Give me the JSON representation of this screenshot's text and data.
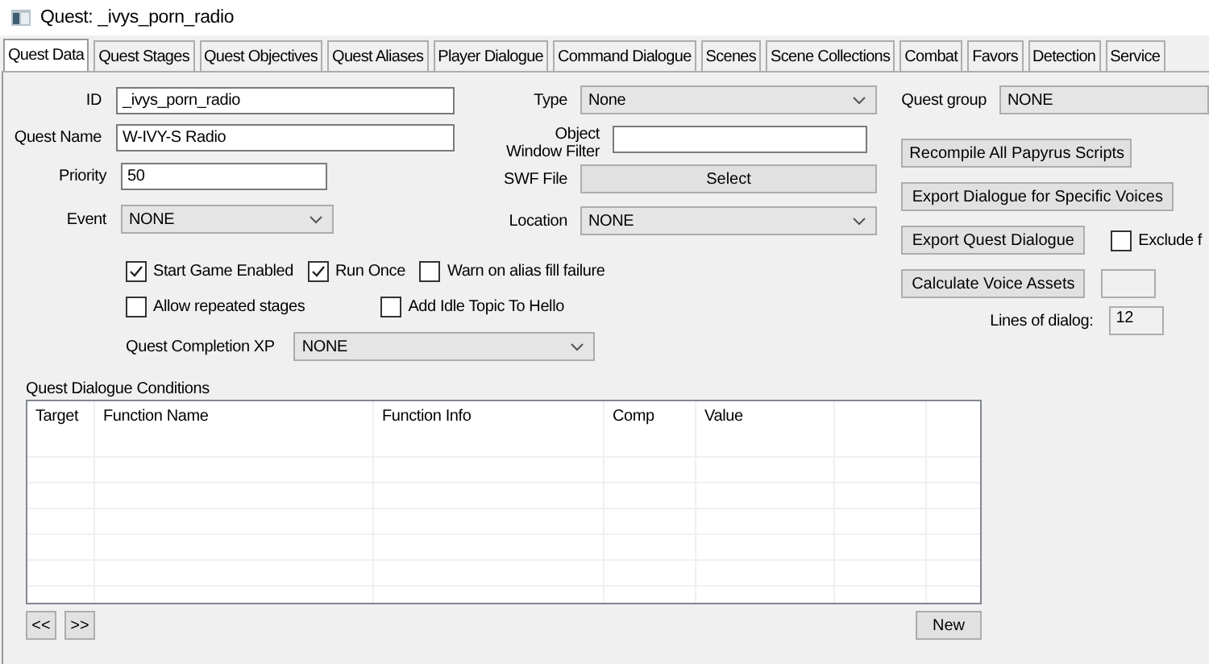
{
  "window": {
    "title": "Quest: _ivys_porn_radio"
  },
  "tabs": [
    {
      "label": "Quest Data",
      "selected": true
    },
    {
      "label": "Quest Stages",
      "selected": false
    },
    {
      "label": "Quest Objectives",
      "selected": false
    },
    {
      "label": "Quest Aliases",
      "selected": false
    },
    {
      "label": "Player Dialogue",
      "selected": false
    },
    {
      "label": "Command Dialogue",
      "selected": false
    },
    {
      "label": "Scenes",
      "selected": false
    },
    {
      "label": "Scene Collections",
      "selected": false
    },
    {
      "label": "Combat",
      "selected": false
    },
    {
      "label": "Favors",
      "selected": false
    },
    {
      "label": "Detection",
      "selected": false
    },
    {
      "label": "Service",
      "selected": false
    }
  ],
  "left_fields": [
    {
      "label": "ID",
      "kind": "text",
      "value": "_ivys_porn_radio"
    },
    {
      "label": "Quest Name",
      "kind": "text",
      "value": "W-IVY-S Radio"
    },
    {
      "label": "Priority",
      "kind": "text",
      "value": "50"
    },
    {
      "label": "Event",
      "kind": "combo",
      "value": "NONE"
    }
  ],
  "middle_fields": [
    {
      "label": "Type",
      "kind": "combo",
      "value": "None"
    },
    {
      "label": "Object Window Filter",
      "kind": "text"
    },
    {
      "label": "SWF File",
      "kind": "button",
      "value": "Select"
    },
    {
      "label": "Location",
      "kind": "combo",
      "value": "NONE"
    }
  ],
  "checkbox_rows": [
    [
      {
        "label": "Start Game Enabled",
        "checked": true
      },
      {
        "label": "Run Once",
        "checked": true
      },
      {
        "label": "Warn on alias fill failure",
        "checked": false
      }
    ],
    [
      {
        "label": "Allow repeated stages",
        "checked": false
      },
      {
        "label": "Add Idle Topic To Hello",
        "checked": false
      }
    ]
  ],
  "completion_xp": {
    "label": "Quest Completion XP",
    "value": "NONE"
  },
  "quest_group": {
    "label": "Quest group",
    "value": "NONE"
  },
  "recompile_button": "Recompile All Papyrus Scripts",
  "export_voices_button": "Export Dialogue for Specific Voices",
  "export_dialogue_button": "Export Quest Dialogue",
  "exclude_checkbox": {
    "label": "Exclude f",
    "checked": false
  },
  "calculate_button": "Calculate Voice Assets",
  "lines_of_dialog": {
    "label": "Lines of dialog:",
    "value": "12"
  },
  "conditions": {
    "title": "Quest Dialogue Conditions",
    "columns": [
      "Target",
      "Function Name",
      "Function Info",
      "Comp",
      "Value"
    ]
  },
  "nav_buttons": [
    "<<",
    ">>"
  ],
  "new_button": "New"
}
